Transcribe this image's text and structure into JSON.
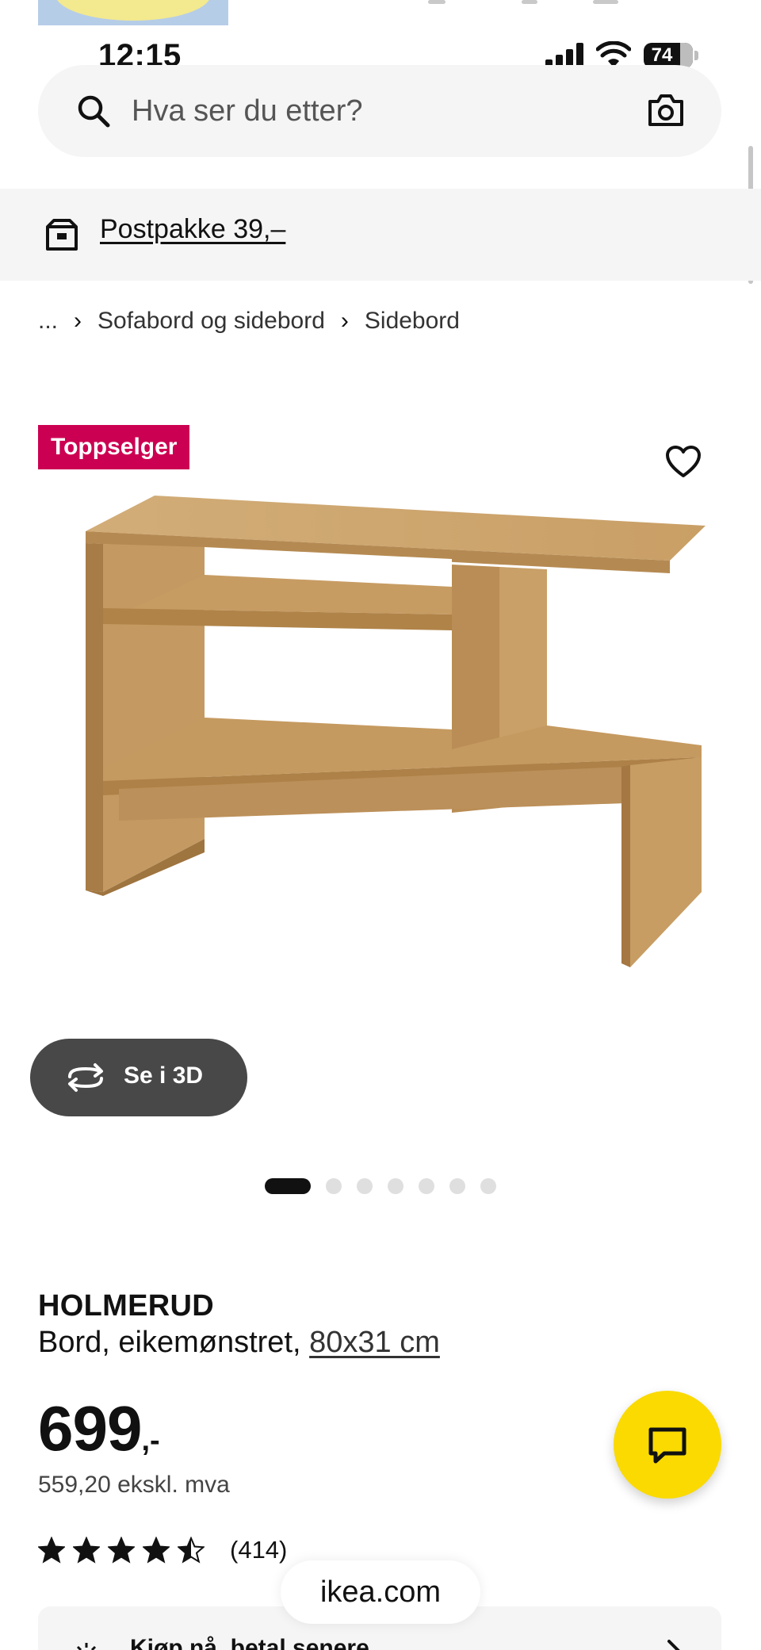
{
  "status_bar": {
    "time": "12:15",
    "battery": "74",
    "battery_fraction": 0.74
  },
  "search": {
    "placeholder": "Hva ser du etter?"
  },
  "delivery": {
    "label": "Postpakke 39,–"
  },
  "breadcrumb": {
    "ellipsis": "...",
    "items": [
      "Sofabord og sidebord",
      "Sidebord"
    ]
  },
  "product": {
    "badge": "Toppselger",
    "view_3d_label": "Se i 3D",
    "image_count": 7,
    "active_image": 1,
    "name": "HOLMERUD",
    "description": "Bord, eikemønstret,",
    "size": "80x31 cm",
    "price": "699",
    "price_suffix": ",-",
    "price_ex_vat": "559,20 ekskl. mva",
    "rating_stars": 4.5,
    "rating_count": "(414)"
  },
  "browser": {
    "url": "ikea.com"
  },
  "promo": {
    "text": "Kjøp nå, betal senere"
  },
  "colors": {
    "badge_bg": "#cc0052",
    "chat_button_bg": "#fada00",
    "banner_bg": "#f5f5f5",
    "button_dark": "#484848"
  }
}
